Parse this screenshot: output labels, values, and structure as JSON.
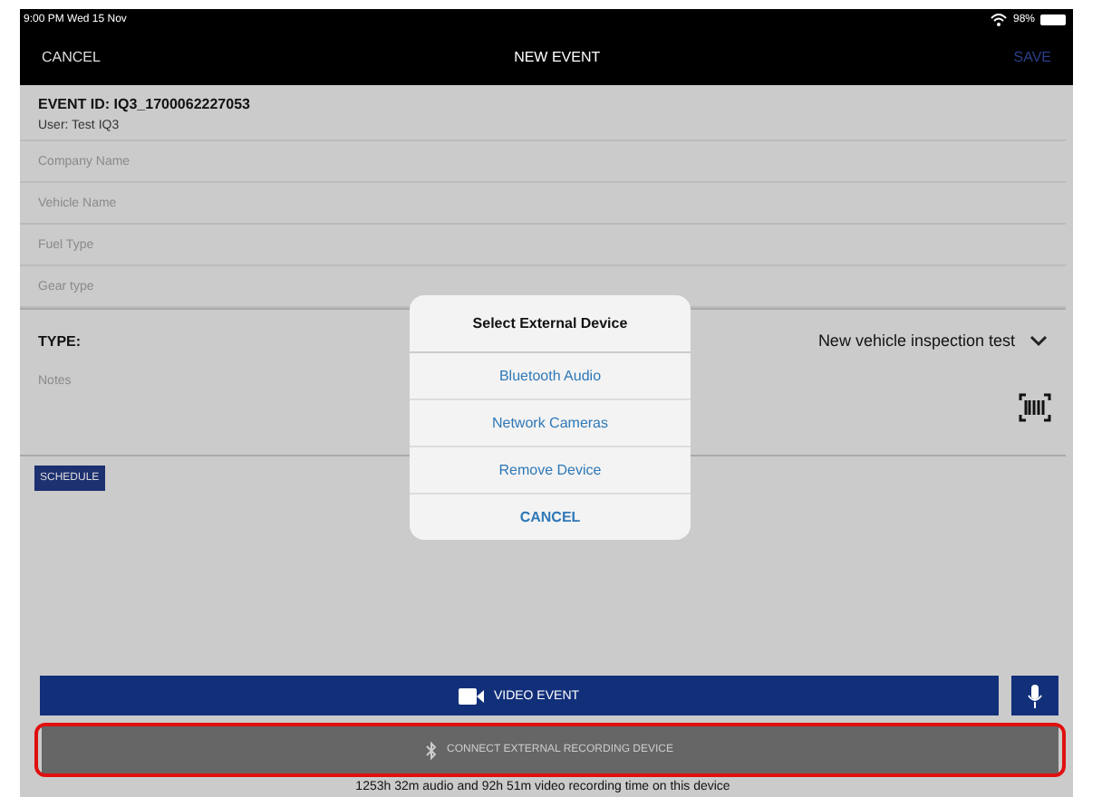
{
  "status_bar": {
    "time": "9:00 PM  Wed 15 Nov",
    "battery": "98%"
  },
  "nav": {
    "left": "CANCEL",
    "title": "NEW EVENT",
    "right": "SAVE"
  },
  "event_id": "EVENT ID: IQ3_1700062227053",
  "user": "User: Test IQ3",
  "fields": [
    {
      "placeholder": "Company Name"
    },
    {
      "placeholder": "Vehicle Name"
    },
    {
      "placeholder": "Fuel Type"
    },
    {
      "placeholder": "Gear type"
    }
  ],
  "type": {
    "label": "TYPE:",
    "value": "New vehicle inspection test"
  },
  "notes": {
    "placeholder": "Notes"
  },
  "schedule_button": "SCHEDULE",
  "dialog": {
    "title": "Select External Device",
    "options": [
      "Bluetooth Audio",
      "Network Cameras",
      "Remove Device"
    ],
    "cancel": "CANCEL"
  },
  "video_button": "VIDEO EVENT",
  "connect_button": {
    "label": "CONNECT EXTERNAL RECORDING DEVICE",
    "highlighted": true
  },
  "footer": "1253h 32m audio and 92h 51m video recording time on this device"
}
